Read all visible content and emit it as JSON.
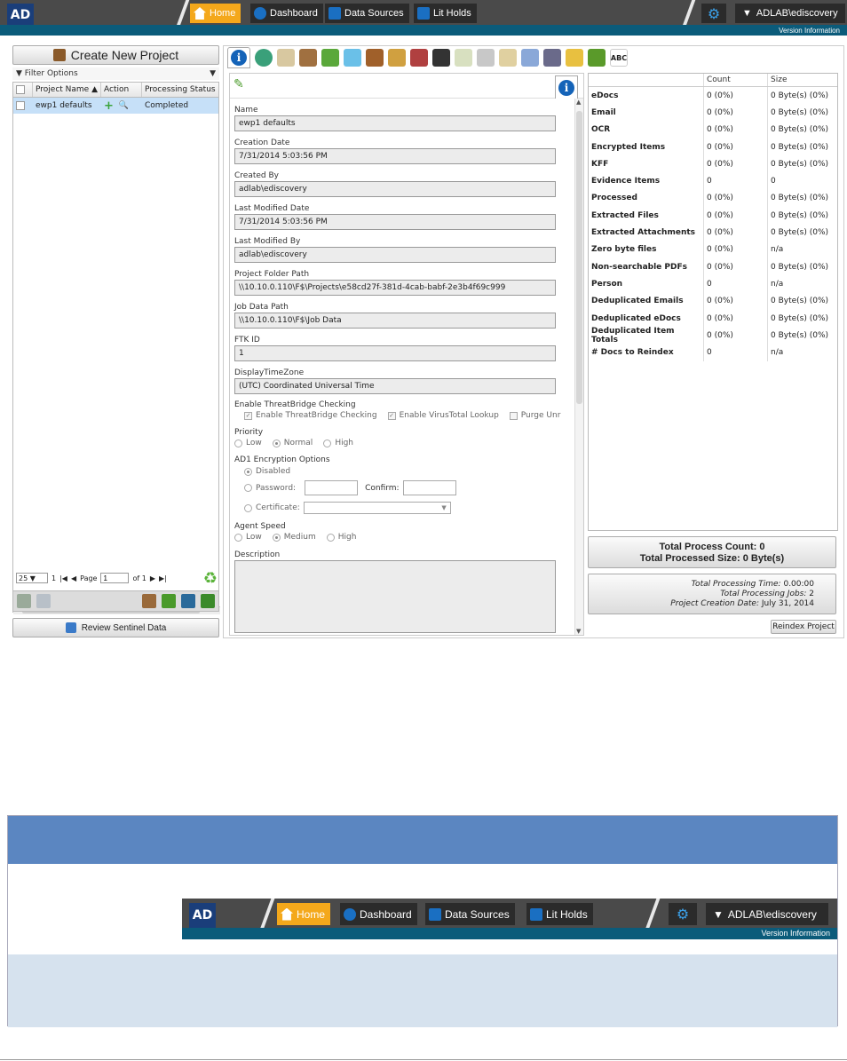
{
  "nav": {
    "logo": "AD",
    "home": "Home",
    "dashboard": "Dashboard",
    "data_sources": "Data Sources",
    "lit_holds": "Lit Holds",
    "user": "ADLAB\\ediscovery",
    "version_info": "Version Information"
  },
  "left": {
    "create_label": "Create New Project",
    "filter_label": "Filter Options",
    "columns": [
      "Project Name",
      "Action",
      "Processing Status"
    ],
    "rows": [
      {
        "name": "ewp1 defaults",
        "status": "Completed"
      }
    ],
    "pager": {
      "page_size": "25",
      "range": "1",
      "page_label": "Page",
      "page_value": "1",
      "of_label": "of 1"
    },
    "review_label": "Review Sentinel Data"
  },
  "form": {
    "name_label": "Name",
    "name_value": "ewp1 defaults",
    "creation_label": "Creation Date",
    "creation_value": "7/31/2014 5:03:56 PM",
    "createdby_label": "Created By",
    "createdby_value": "adlab\\ediscovery",
    "lastmod_label": "Last Modified Date",
    "lastmod_value": "7/31/2014 5:03:56 PM",
    "lastmodby_label": "Last Modified By",
    "lastmodby_value": "adlab\\ediscovery",
    "folder_label": "Project Folder Path",
    "folder_value": "\\\\10.10.0.110\\F$\\Projects\\e58cd27f-381d-4cab-babf-2e3b4f69c999",
    "job_label": "Job Data Path",
    "job_value": "\\\\10.10.0.110\\F$\\Job Data",
    "ftk_label": "FTK ID",
    "ftk_value": "1",
    "tz_label": "DisplayTimeZone",
    "tz_value": "(UTC) Coordinated Universal Time",
    "threat_label": "Enable ThreatBridge Checking",
    "threat_opt1": "Enable ThreatBridge Checking",
    "threat_opt2": "Enable VirusTotal Lookup",
    "threat_opt3": "Purge Unr",
    "priority_label": "Priority",
    "priority_low": "Low",
    "priority_normal": "Normal",
    "priority_high": "High",
    "ad1_label": "AD1 Encryption Options",
    "ad1_disabled": "Disabled",
    "ad1_password": "Password:",
    "ad1_confirm": "Confirm:",
    "ad1_cert": "Certificate:",
    "speed_label": "Agent Speed",
    "speed_low": "Low",
    "speed_medium": "Medium",
    "speed_high": "High",
    "desc_label": "Description"
  },
  "stats": {
    "headers": [
      "",
      "Count",
      "Size"
    ],
    "rows": [
      [
        "eDocs",
        "0 (0%)",
        "0 Byte(s) (0%)"
      ],
      [
        "Email",
        "0 (0%)",
        "0 Byte(s) (0%)"
      ],
      [
        "OCR",
        "0 (0%)",
        "0 Byte(s) (0%)"
      ],
      [
        "Encrypted Items",
        "0 (0%)",
        "0 Byte(s) (0%)"
      ],
      [
        "KFF",
        "0 (0%)",
        "0 Byte(s) (0%)"
      ],
      [
        "Evidence Items",
        "0",
        "0"
      ],
      [
        "Processed",
        "0 (0%)",
        "0 Byte(s) (0%)"
      ],
      [
        "Extracted Files",
        "0 (0%)",
        "0 Byte(s) (0%)"
      ],
      [
        "Extracted Attachments",
        "0 (0%)",
        "0 Byte(s) (0%)"
      ],
      [
        "Zero byte files",
        "0 (0%)",
        "n/a"
      ],
      [
        "Non-searchable PDFs",
        "0 (0%)",
        "0 Byte(s) (0%)"
      ],
      [
        "Person",
        "0",
        "n/a"
      ],
      [
        "Deduplicated Emails",
        "0 (0%)",
        "0 Byte(s) (0%)"
      ],
      [
        "Deduplicated eDocs",
        "0 (0%)",
        "0 Byte(s) (0%)"
      ],
      [
        "Deduplicated Item Totals",
        "0 (0%)",
        "0 Byte(s) (0%)"
      ],
      [
        "# Docs to Reindex",
        "0",
        "n/a"
      ]
    ],
    "total_count_label": "Total Process Count:",
    "total_count_value": "0",
    "total_size_label": "Total Processed Size:",
    "total_size_value": "0 Byte(s)",
    "time_label": "Total Processing Time:",
    "time_value": "0.00:00",
    "jobs_label": "Total Processing Jobs:",
    "jobs_value": "2",
    "created_label": "Project Creation Date:",
    "created_value": "July 31, 2014",
    "reindex_label": "Reindex Project"
  },
  "colors": {
    "nav_bg": "#4a4a4a",
    "nav_band": "#0b5b7a",
    "home_active": "#f4a81b",
    "selected_row": "#c6e0f8",
    "section_header": "#5b86c1",
    "section_footer": "#d6e2ee"
  }
}
